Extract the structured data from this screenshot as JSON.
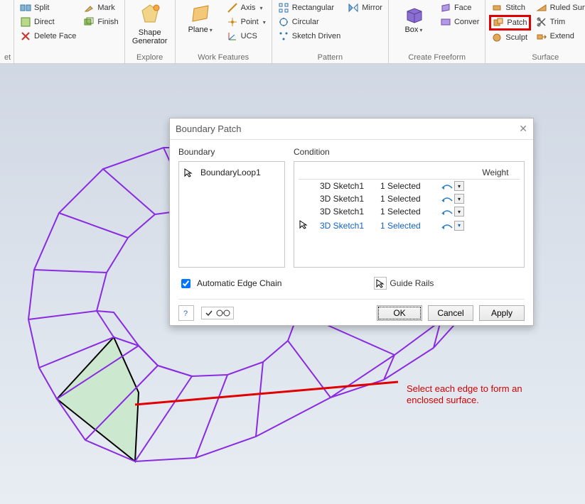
{
  "ribbon": {
    "groups": {
      "modify": {
        "split": "Split",
        "direct": "Direct",
        "deleteFace": "Delete Face",
        "mark": "Mark",
        "finish": "Finish"
      },
      "explore": {
        "shapeGen_top": "Shape",
        "shapeGen_bot": "Generator",
        "label": "Explore"
      },
      "workFeatures": {
        "plane": "Plane",
        "axis": "Axis",
        "point": "Point",
        "ucs": "UCS",
        "label": "Work Features"
      },
      "pattern": {
        "rect": "Rectangular",
        "circ": "Circular",
        "sketch": "Sketch Driven",
        "mirror": "Mirror",
        "label": "Pattern"
      },
      "freeform": {
        "box": "Box",
        "face": "Face",
        "convert": "Conver",
        "label": "Create Freeform"
      },
      "surface": {
        "stitch": "Stitch",
        "patch": "Patch",
        "sculpt": "Sculpt",
        "ruled": "Ruled Surface",
        "trim": "Trim",
        "extend": "Extend",
        "label": "Surface"
      }
    }
  },
  "dialog": {
    "title": "Boundary Patch",
    "boundaryHeader": "Boundary",
    "conditionHeader": "Condition",
    "weightHeader": "Weight",
    "loop": "BoundaryLoop1",
    "rows": [
      {
        "sketch": "3D Sketch1",
        "sel": "1 Selected",
        "active": false
      },
      {
        "sketch": "3D Sketch1",
        "sel": "1 Selected",
        "active": false
      },
      {
        "sketch": "3D Sketch1",
        "sel": "1 Selected",
        "active": false
      },
      {
        "sketch": "3D Sketch1",
        "sel": "1 Selected",
        "active": true
      }
    ],
    "autoEdge": "Automatic Edge Chain",
    "guideRails": "Guide Rails",
    "ok": "OK",
    "cancel": "Cancel",
    "apply": "Apply"
  },
  "annotation": {
    "line1": "Select each edge to form an",
    "line2": "enclosed surface."
  }
}
